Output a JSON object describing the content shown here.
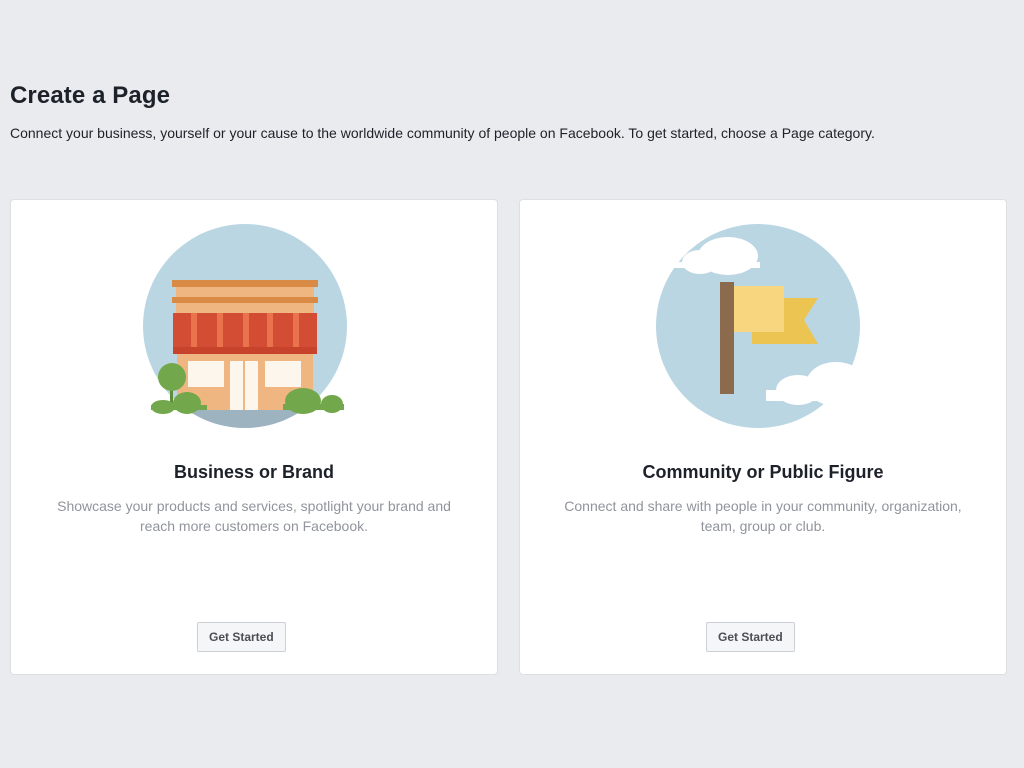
{
  "header": {
    "title": "Create a Page",
    "subtitle": "Connect your business, yourself or your cause to the worldwide community of people on Facebook. To get started, choose a Page category."
  },
  "cards": [
    {
      "illustration": "storefront-icon",
      "title": "Business or Brand",
      "description": "Showcase your products and services, spotlight your brand and reach more customers on Facebook.",
      "button_label": "Get Started"
    },
    {
      "illustration": "flag-icon",
      "title": "Community or Public Figure",
      "description": "Connect and share with people in your community, organization, team, group or club.",
      "button_label": "Get Started"
    }
  ],
  "colors": {
    "background": "#e9ebee",
    "card": "#ffffff",
    "circle": "#bad6e3",
    "awning": "#d24d33",
    "storefront": "#f0b681",
    "flag": "#f7d67f",
    "flag_shadow": "#ecc452",
    "pole": "#8b6a4e",
    "bush": "#72a84b"
  }
}
